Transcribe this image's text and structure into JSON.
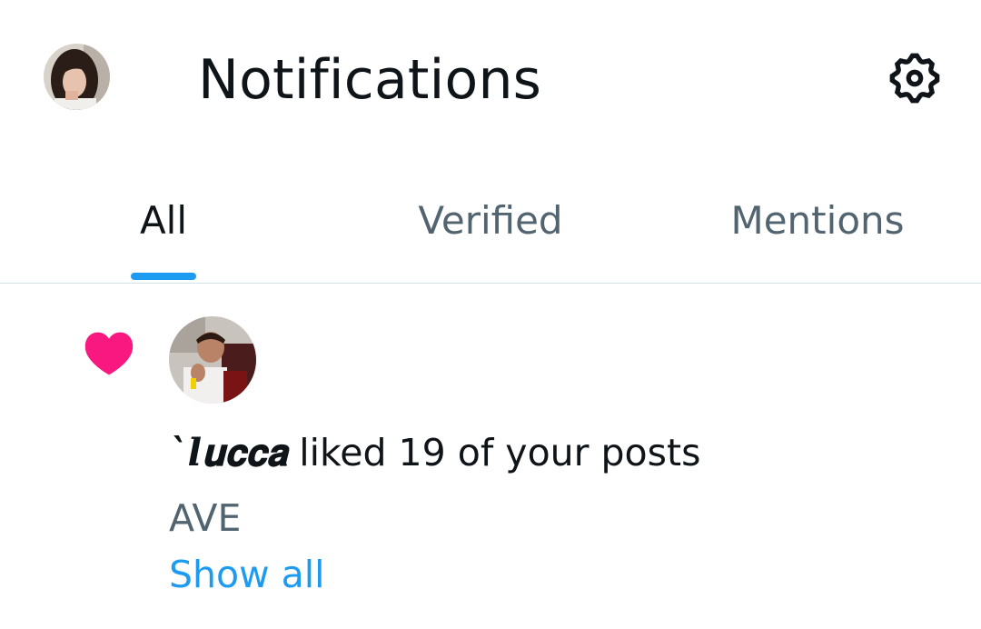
{
  "header": {
    "title": "Notifications",
    "profile_icon": "user-avatar",
    "settings_icon": "gear-icon"
  },
  "tabs": [
    {
      "label": "All",
      "active": true
    },
    {
      "label": "Verified",
      "active": false
    },
    {
      "label": "Mentions",
      "active": false
    }
  ],
  "notification": {
    "type_icon": "heart-icon",
    "actor_name": "`𝒍𝐮𝐜𝐜𝐚",
    "action_text": " liked 19 of your posts",
    "preview_text": "AVE",
    "show_all_label": "Show all"
  },
  "colors": {
    "accent": "#1d9bf0",
    "like": "#f91880",
    "primary_text": "#0f1419",
    "secondary_text": "#536471",
    "divider": "#cfe3e7"
  }
}
